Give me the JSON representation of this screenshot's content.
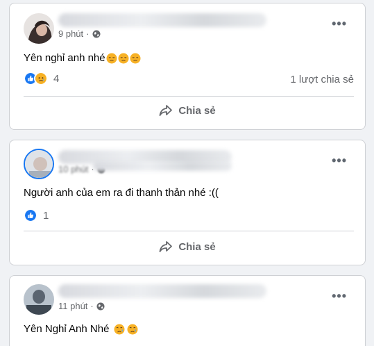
{
  "posts": [
    {
      "time": "9 phút",
      "text": "Yên nghỉ anh nhé",
      "emojis": [
        "disappointed-face",
        "disappointed-face",
        "disappointed-face"
      ],
      "reactions": [
        "like",
        "sad"
      ],
      "reaction_count": "4",
      "share_count": "1 lượt chia sẻ",
      "share_label": "Chia sẻ"
    },
    {
      "time": "10 phút",
      "text": "Người anh của em ra đi thanh thản nhé :((",
      "emojis": [],
      "reactions": [
        "like"
      ],
      "reaction_count": "1",
      "share_count": "",
      "share_label": "Chia sẻ"
    },
    {
      "time": "11 phút",
      "text": "Yên Nghỉ Anh Nhé",
      "emojis": [
        "crying-face",
        "crying-face"
      ],
      "reactions": [],
      "reaction_count": "",
      "share_count": "",
      "share_label": ""
    }
  ],
  "more_label": "•••",
  "colors": {
    "like_blue": "#1877f2",
    "sad_yellow": "#f7b125",
    "secondary_text": "#65676b",
    "divider": "#ced0d4"
  }
}
